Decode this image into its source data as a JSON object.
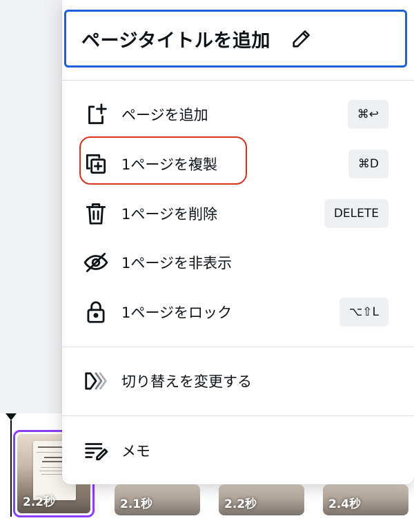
{
  "menu": {
    "title": "ページタイトルを追加",
    "title_icon": "pencil-icon",
    "items": [
      {
        "label": "ページを追加",
        "icon": "add-page-icon",
        "shortcut": "⌘↩"
      },
      {
        "label": "1ページを複製",
        "icon": "duplicate-page-icon",
        "shortcut": "⌘D",
        "highlighted": true
      },
      {
        "label": "1ページを削除",
        "icon": "trash-icon",
        "shortcut": "DELETE"
      },
      {
        "label": "1ページを非表示",
        "icon": "eye-off-icon",
        "shortcut": ""
      },
      {
        "label": "1ページをロック",
        "icon": "lock-icon",
        "shortcut": "⌥⇧L"
      },
      {
        "label": "切り替えを変更する",
        "icon": "transition-icon",
        "shortcut": ""
      },
      {
        "label": "メモ",
        "icon": "notes-icon",
        "shortcut": ""
      }
    ]
  },
  "timeline": {
    "pages": [
      {
        "duration": "2.2秒",
        "selected": true
      },
      {
        "duration": "2.1秒",
        "selected": false
      },
      {
        "duration": "2.2秒",
        "selected": false
      },
      {
        "duration": "2.4秒",
        "selected": false
      }
    ]
  },
  "colors": {
    "title_border": "#1c5fd6",
    "highlight_ring": "#d8301a",
    "selected_page_border": "#8b3dff"
  }
}
